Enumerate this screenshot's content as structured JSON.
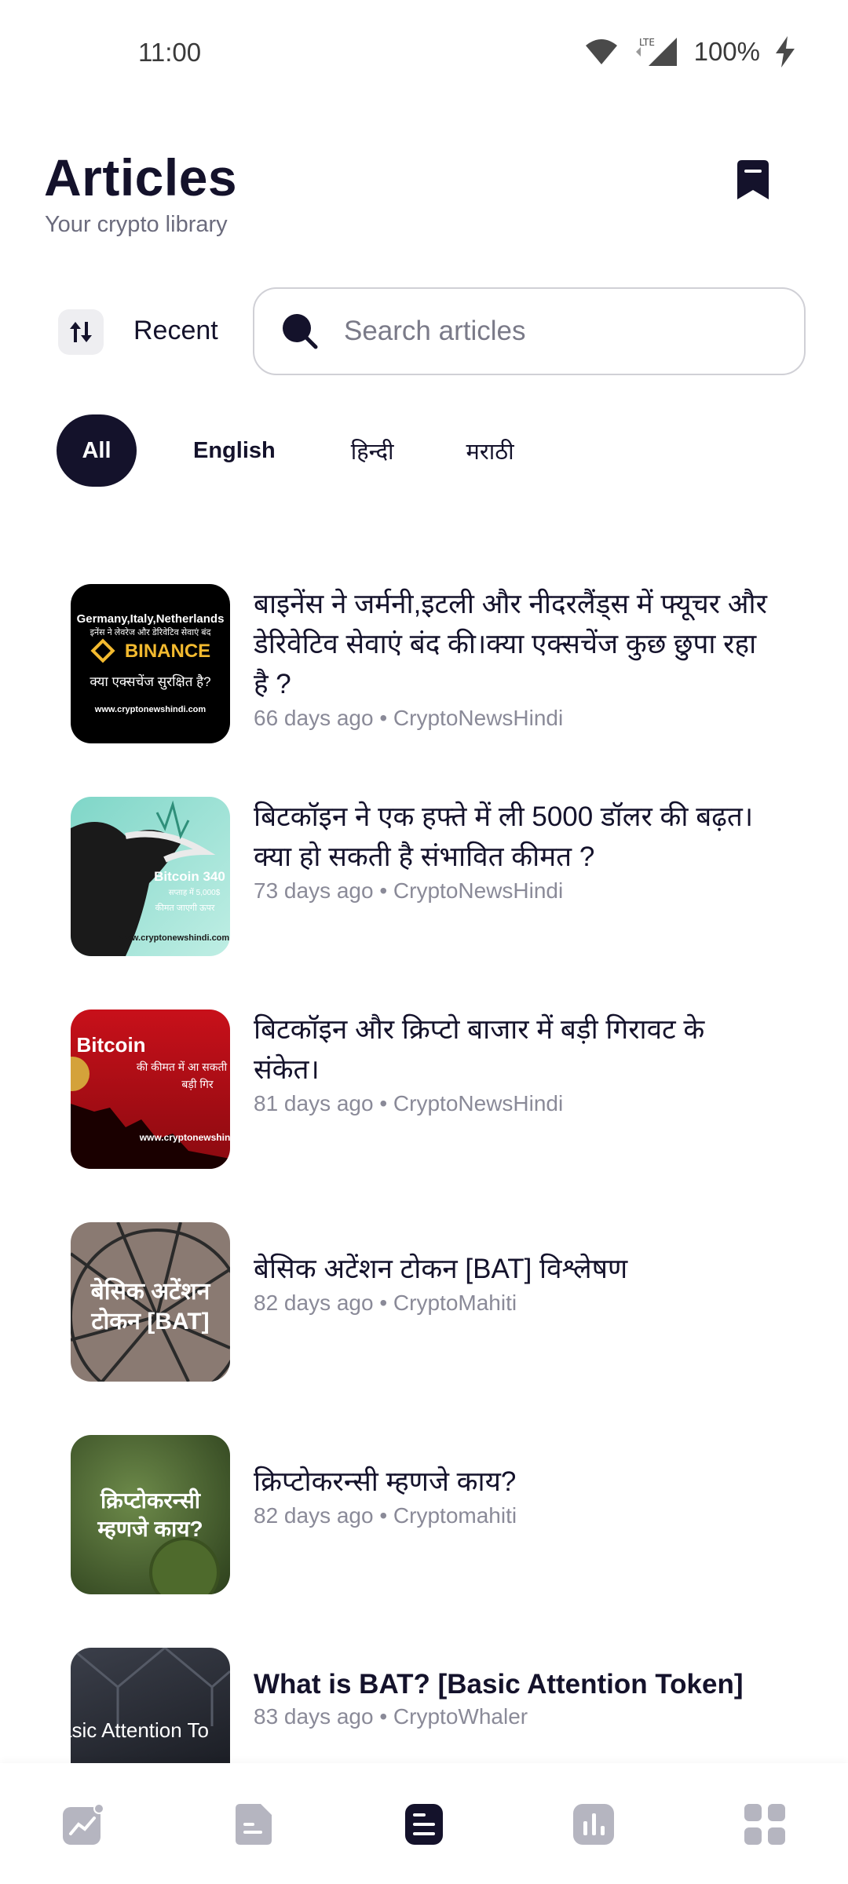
{
  "status_bar": {
    "time": "11:00",
    "network": "LTE",
    "battery": "100%"
  },
  "header": {
    "title": "Articles",
    "subtitle": "Your crypto library"
  },
  "sort": {
    "label": "Recent"
  },
  "search": {
    "placeholder": "Search articles"
  },
  "filters": [
    {
      "label": "All",
      "active": true
    },
    {
      "label": "English",
      "active": false
    },
    {
      "label": "हिन्दी",
      "active": false
    },
    {
      "label": "मराठी",
      "active": false
    }
  ],
  "articles": [
    {
      "title": "बाइनेंस ने जर्मनी,इटली और नीदरलैंड्स में फ्यूचर और डेरिवेटिव सेवाएं बंद की।क्या एक्सचेंज कुछ छुपा रहा है ?",
      "meta": "66 days ago • CryptoNewsHindi",
      "thumb_lines": [
        "Germany,Italy,Netherlands",
        "इनेंस ने लेवरेज और डेरिवेटिव सेवाएं बंद",
        "BINANCE",
        "क्या एक्सचेंज सुरक्षित है?",
        "www.cryptonewshindi.com"
      ]
    },
    {
      "title": "बिटकॉइन ने एक हफ्ते में ली 5000 डॉलर की बढ़त।क्या हो सकती है संभावित कीमत ?",
      "meta": "73 days ago • CryptoNewsHindi",
      "thumb_lines": [
        "Bitcoin 340",
        "सप्ताह में 5,000$",
        "कीमत जाएगी ऊपर",
        "www.cryptonewshindi.com"
      ]
    },
    {
      "title": "बिटकॉइन और क्रिप्टो बाजार में बड़ी गिरावट के संकेत।",
      "meta": "81 days ago • CryptoNewsHindi",
      "thumb_lines": [
        "Bitcoin",
        "की कीमत में आ सकती",
        "बड़ी गिर",
        "www.cryptonewshin"
      ]
    },
    {
      "title": "बेसिक अटेंशन टोकन [BAT] विश्लेषण",
      "meta": "82 days ago • CryptoMahiti",
      "thumb_lines": [
        "बेसिक अटेंशन",
        "टोकन [BAT]"
      ]
    },
    {
      "title": "क्रिप्टोकरन्सी म्हणजे काय?",
      "meta": "82 days ago • Cryptomahiti",
      "thumb_lines": [
        "क्रिप्टोकरन्सी",
        "म्हणजे काय?"
      ]
    },
    {
      "title": "What is BAT? [Basic Attention Token]",
      "meta": "83 days ago • CryptoWhaler",
      "thumb_lines": [
        "asic Attention To"
      ]
    }
  ],
  "bottom_nav": [
    {
      "icon": "chart-trend-icon",
      "active": false
    },
    {
      "icon": "document-icon",
      "active": false
    },
    {
      "icon": "articles-icon",
      "active": true
    },
    {
      "icon": "bar-chart-icon",
      "active": false
    },
    {
      "icon": "grid-icon",
      "active": false
    }
  ],
  "colors": {
    "primary": "#14122b",
    "muted": "#8a8a98",
    "inactive_icon": "#b5b5c0"
  }
}
